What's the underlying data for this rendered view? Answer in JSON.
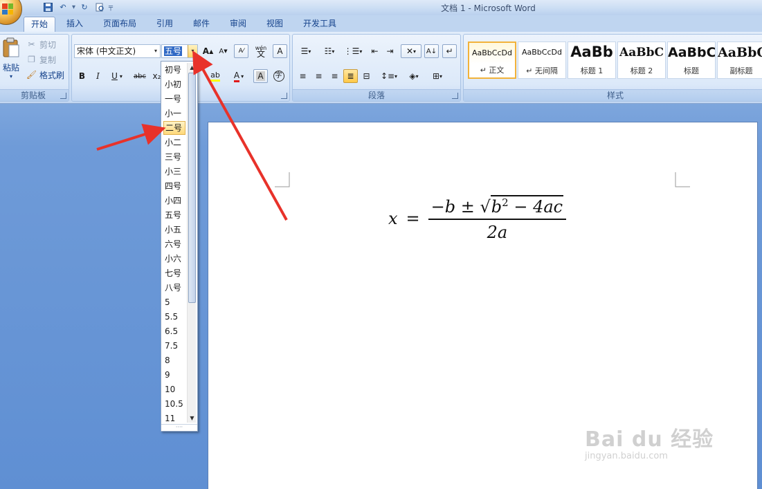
{
  "window": {
    "title": "文档 1 - Microsoft Word"
  },
  "tabs": [
    {
      "label": "开始",
      "active": true
    },
    {
      "label": "插入"
    },
    {
      "label": "页面布局"
    },
    {
      "label": "引用"
    },
    {
      "label": "邮件"
    },
    {
      "label": "审阅"
    },
    {
      "label": "视图"
    },
    {
      "label": "开发工具"
    }
  ],
  "clipboard": {
    "paste": "粘贴",
    "cut": "剪切",
    "copy": "复制",
    "format_painter": "格式刷",
    "group": "剪贴板"
  },
  "font": {
    "face": "宋体 (中文正文)",
    "size": "五号",
    "grow": "A",
    "shrink": "A",
    "bold": "B",
    "italic": "I",
    "underline": "U",
    "strike": "abc",
    "subscript": "x₂",
    "font_color": "A",
    "char_shading": "A",
    "enclose": "字",
    "phonetic": "wén",
    "phonetic_char": "文",
    "char_border": "A",
    "clear": "A"
  },
  "paragraph": {
    "group": "段落"
  },
  "styles": {
    "group": "样式",
    "items": [
      {
        "sample": "AaBbCcDd",
        "name": "↵ 正文",
        "selected": true
      },
      {
        "sample": "AaBbCcDd",
        "name": "↵ 无间隔"
      },
      {
        "sample": "AaBb",
        "name": "标题 1"
      },
      {
        "sample": "AaBbC",
        "name": "标题 2"
      },
      {
        "sample": "AaBbC",
        "name": "标题"
      },
      {
        "sample": "AaBbC",
        "name": "副标题"
      }
    ]
  },
  "font_size_list": {
    "highlighted": "二号",
    "items": [
      "初号",
      "小初",
      "一号",
      "小一",
      "二号",
      "小二",
      "三号",
      "小三",
      "四号",
      "小四",
      "五号",
      "小五",
      "六号",
      "小六",
      "七号",
      "八号",
      "5",
      "5.5",
      "6.5",
      "7.5",
      "8",
      "9",
      "10",
      "10.5",
      "11"
    ]
  },
  "document": {
    "formula": {
      "lhs": "x",
      "equals": "=",
      "numerator_pre": "−b ± ",
      "radicand": "b",
      "exp": "2",
      "radicand_post": " − 4ac",
      "denominator": "2a"
    }
  },
  "watermark": {
    "brand": "Bai du 经验",
    "url": "jingyan.baidu.com"
  },
  "colors": {
    "accent": "#e8322a",
    "highlight": "#ffd97a",
    "ribbon": "#dce9f9"
  }
}
